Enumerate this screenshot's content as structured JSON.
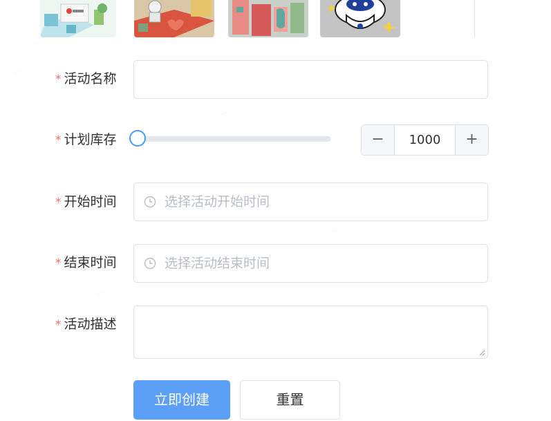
{
  "form": {
    "activity_name": {
      "label": "活动名称",
      "required_mark": "*",
      "value": ""
    },
    "stock": {
      "label": "计划库存",
      "required_mark": "*",
      "slider_level": 0,
      "value": "1000",
      "decrement": "−",
      "increment": "+"
    },
    "start_time": {
      "label": "开始时间",
      "required_mark": "*",
      "placeholder": "选择活动开始时间",
      "icon": "clock-icon"
    },
    "end_time": {
      "label": "结束时间",
      "required_mark": "*",
      "placeholder": "选择活动结束时间",
      "icon": "clock-icon"
    },
    "description": {
      "label": "活动描述",
      "required_mark": "*",
      "value": ""
    },
    "buttons": {
      "create": "立即创建",
      "reset": "重置"
    }
  },
  "theme": {
    "primary": "#409eff",
    "primary_button": "#5c9ff6",
    "required": "#f56c6c",
    "border": "#dcdfe6",
    "placeholder": "#b7bcc6"
  },
  "images": [
    {
      "name": "thumbnail-kingdom-scene"
    },
    {
      "name": "thumbnail-astronaut-room"
    },
    {
      "name": "thumbnail-letters-scene"
    },
    {
      "name": "thumbnail-cartoon-mascot"
    }
  ]
}
